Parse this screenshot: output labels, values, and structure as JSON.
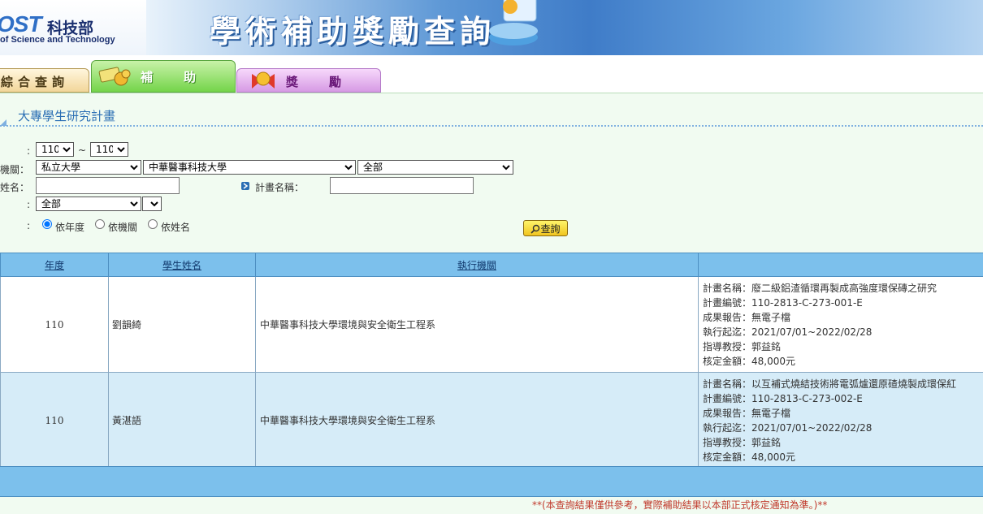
{
  "header": {
    "logo_abbr": "OST",
    "logo_ministry": "科技部",
    "logo_sub": "of Science and Technology",
    "site_title": "學術補助獎勵查詢"
  },
  "tabs": [
    {
      "label": "綜合查詢"
    },
    {
      "label": "補助"
    },
    {
      "label": "獎勵"
    }
  ],
  "section": {
    "title": "大專學生研究計畫"
  },
  "form": {
    "colon": ":",
    "tilde": "~",
    "year_from": "110",
    "year_to": "110",
    "institution_label": "機關：",
    "institution_type": "私立大學",
    "institution_name": "中華醫事科技大學",
    "department": "全部",
    "name_label": "姓名：",
    "name_value": "",
    "project_name_label": "計畫名稱：",
    "project_name_value": "",
    "category": "全部",
    "subcategory": "",
    "sort_options": [
      "依年度",
      "依機關",
      "依姓名"
    ],
    "sort_selected": "依年度",
    "query_button": "查詢"
  },
  "table": {
    "headers": [
      "年度",
      "學生姓名",
      "執行機關",
      ""
    ],
    "rows": [
      {
        "year": "110",
        "student": "劉韻綺",
        "institution": "中華醫事科技大學環境與安全衛生工程系",
        "details": [
          "計畫名稱：廢二級鋁渣循環再製成高強度環保磚之研究",
          "計畫編號：110-2813-C-273-001-E",
          "成果報告：無電子檔",
          "執行起迄：2021/07/01~2022/02/28",
          "指導教授：郭益銘",
          "核定金額：48,000元"
        ]
      },
      {
        "year": "110",
        "student": "黃湛語",
        "institution": "中華醫事科技大學環境與安全衛生工程系",
        "details": [
          "計畫名稱：以互補式燒結技術將電弧爐還原碴燒製成環保紅",
          "計畫編號：110-2813-C-273-002-E",
          "成果報告：無電子檔",
          "執行起迄：2021/07/01~2022/02/28",
          "指導教授：郭益銘",
          "核定金額：48,000元"
        ]
      }
    ]
  },
  "notice": "**(本查詢結果僅供參考，實際補助結果以本部正式核定通知為準。)**",
  "colors": {
    "header_blue": "#3f7cc8",
    "table_header": "#7cc0ec",
    "row_alt": "#d6ecf8",
    "notice_red": "#c0392b"
  }
}
